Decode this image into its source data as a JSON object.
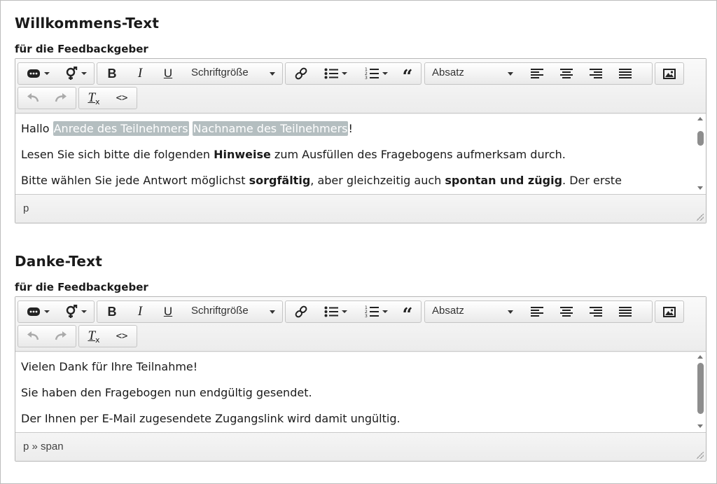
{
  "sections": [
    {
      "title": "Willkommens-Text",
      "subtitle": "für die Feedbackgeber",
      "content": {
        "line1": {
          "prefix": "Hallo ",
          "placeholder1": "Anrede des Teilnehmers",
          "space": " ",
          "placeholder2": "Nachname des Teilnehmers",
          "suffix": "!"
        },
        "line2": {
          "a": "Lesen Sie sich bitte die folgenden ",
          "b": "Hinweise",
          "c": " zum Ausfüllen des Fragebogens aufmerksam durch."
        },
        "line3": {
          "a": "Bitte wählen Sie jede Antwort möglichst ",
          "b": "sorgfältig",
          "c": ", aber gleichzeitig auch ",
          "d": "spontan und zügig",
          "e": ". Der erste"
        }
      },
      "status_path": "p",
      "scroll": {
        "position": 0.15,
        "visible_fraction": 0.25
      }
    },
    {
      "title": "Danke-Text",
      "subtitle": "für die Feedbackgeber",
      "content": {
        "line1": "Vielen Dank für Ihre Teilnahme!",
        "line2": "Sie haben den Fragebogen nun endgültig gesendet.",
        "line3": "Der Ihnen per E-Mail zugesendete Zugangslink wird damit ungültig."
      },
      "status_path": "p » span",
      "scroll": {
        "position": 0.1,
        "visible_fraction": 0.85
      }
    }
  ],
  "toolbar": {
    "font_size_label": "Schriftgröße",
    "format_label": "Absatz",
    "icons": {
      "placeholder": "placeholder-icon",
      "gender": "gender-icon",
      "bold": "bold-icon",
      "italic": "italic-icon",
      "underline": "underline-icon",
      "link": "link-icon",
      "bullet_list": "bullet-list-icon",
      "numbered_list": "numbered-list-icon",
      "blockquote": "blockquote-icon",
      "align_left": "align-left-icon",
      "align_center": "align-center-icon",
      "align_right": "align-right-icon",
      "justify": "justify-icon",
      "image": "image-icon",
      "undo": "undo-icon",
      "redo": "redo-icon",
      "clear_format": "clear-format-icon",
      "source_code": "source-code-icon"
    }
  },
  "colors": {
    "placeholder_bg": "#b4bec0",
    "scroll_thumb": "#8d8d8d"
  }
}
